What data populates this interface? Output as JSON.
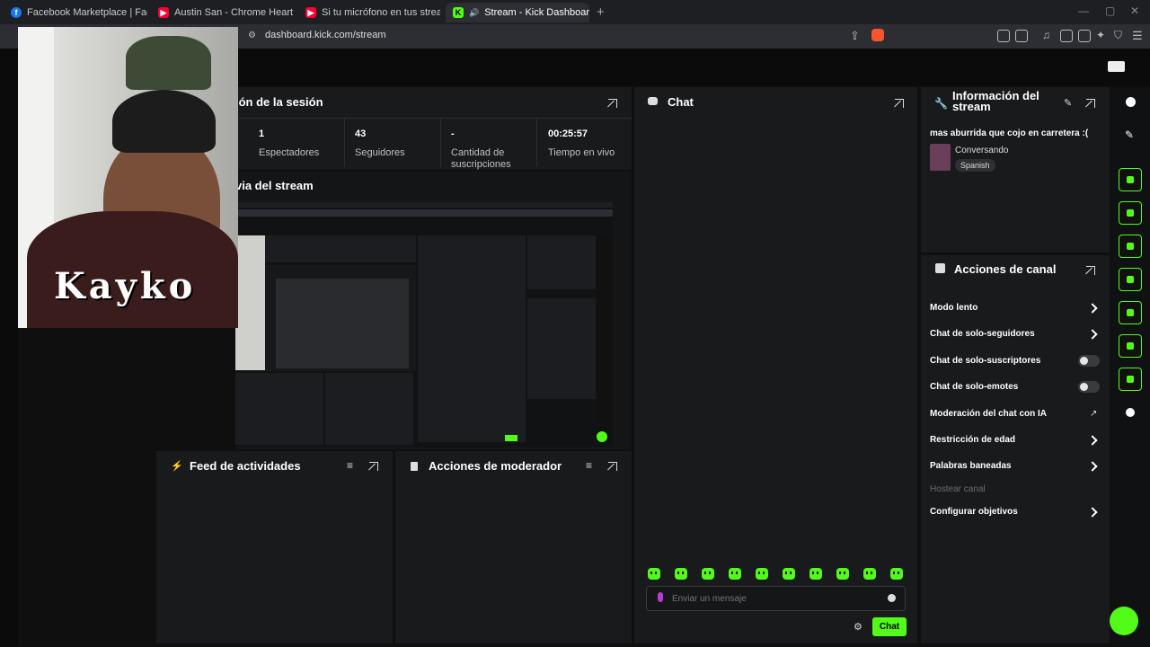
{
  "browser": {
    "tabs": [
      {
        "title": "Facebook Marketplace | Facebook",
        "icon": "facebook-icon"
      },
      {
        "title": "Austin San - Chrome Hearts (Video O",
        "icon": "youtube-icon"
      },
      {
        "title": "Si tu micrófono en tus streams se esc",
        "icon": "youtube-icon"
      },
      {
        "title": "Stream - Kick Dashboard",
        "icon": "kick-icon",
        "active": true
      }
    ],
    "url": "dashboard.kick.com/stream"
  },
  "session": {
    "title": "ión de la sesión",
    "stats": [
      {
        "value": "1",
        "label": "Espectadores"
      },
      {
        "value": "43",
        "label": "Seguidores"
      },
      {
        "value": "-",
        "label": "Cantidad de suscripciones"
      },
      {
        "value": "00:25:57",
        "label": "Tiempo en vivo"
      }
    ]
  },
  "preview": {
    "title": "via del stream"
  },
  "chat": {
    "title": "Chat",
    "placeholder": "Enviar un mensaje",
    "send_label": "Chat"
  },
  "feed": {
    "title": "Feed de actividades"
  },
  "moderator": {
    "title": "Acciones de moderador"
  },
  "stream_info": {
    "title": "Información del stream",
    "stream_title": "mas aburrida que cojo en carretera :(",
    "category": "Conversando",
    "language": "Spanish"
  },
  "channel_actions": {
    "title": "Acciones de canal",
    "items": [
      {
        "label": "Modo lento",
        "control": "chevron"
      },
      {
        "label": "Chat de solo-seguidores",
        "control": "chevron"
      },
      {
        "label": "Chat de solo-suscriptores",
        "control": "toggle",
        "on": false
      },
      {
        "label": "Chat de solo-emotes",
        "control": "toggle",
        "on": false
      },
      {
        "label": "Moderación del chat con IA",
        "control": "external"
      },
      {
        "label": "Restricción de edad",
        "control": "chevron"
      },
      {
        "label": "Palabras baneadas",
        "control": "chevron"
      },
      {
        "label": "Hostear canal",
        "control": "disabled"
      },
      {
        "label": "Configurar objetivos",
        "control": "chevron"
      }
    ]
  },
  "webcam_overlay": {
    "text": "Kayko"
  },
  "colors": {
    "accent": "#53fc18",
    "panel": "#191a1c",
    "background": "#0f0f10"
  }
}
